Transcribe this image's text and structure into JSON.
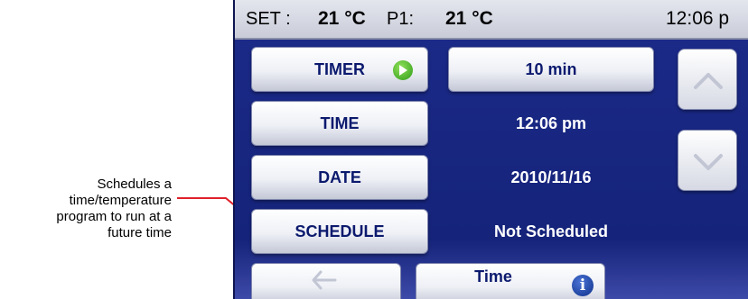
{
  "callout": {
    "lines": [
      "Schedules a",
      "time/temperature",
      "program to run at a",
      "future time"
    ]
  },
  "status": {
    "set_label": "SET :",
    "set_value": "21 °C",
    "p1_label": "P1:",
    "p1_value": "21 °C",
    "clock": "12:06 p"
  },
  "rows": {
    "timer_label": "TIMER",
    "timer_value": "10 min",
    "time_label": "TIME",
    "time_value": "12:06 pm",
    "date_label": "DATE",
    "date_value": "2010/11/16",
    "schedule_label": "SCHEDULE",
    "schedule_value": "Not Scheduled"
  },
  "bottom": {
    "center_label": "Time"
  },
  "colors": {
    "screen_bg": "#1c2b8a",
    "button_text": "#0c1a6e",
    "callout_red": "#e0202a",
    "play_green": "#3aa81e"
  },
  "icons": {
    "timer_status": "play-icon",
    "scroll_up": "chevron-up-icon",
    "scroll_down": "chevron-down-icon",
    "back": "back-arrow-icon",
    "info": "info-icon"
  }
}
